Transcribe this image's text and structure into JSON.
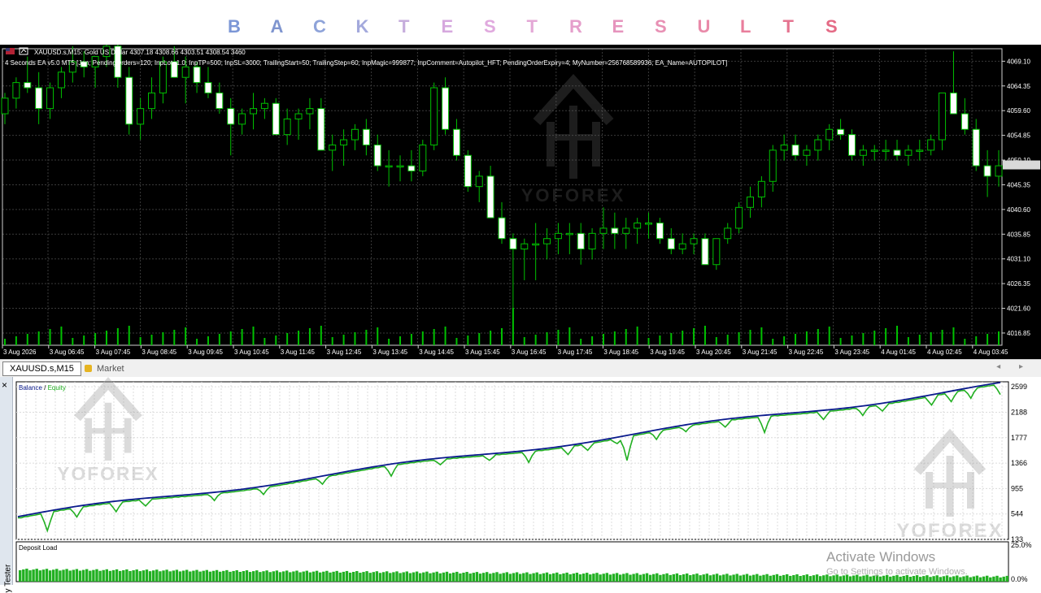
{
  "banner": {
    "letters": [
      "B",
      "A",
      "C",
      "K",
      "T",
      "E",
      "S",
      "T",
      "R",
      "E",
      "S",
      "U",
      "L",
      "T",
      "S"
    ],
    "colors": [
      "#7b96d6",
      "#7f95cf",
      "#8ea3d9",
      "#a3a9dc",
      "#c6addc",
      "#d6a8de",
      "#e0a9de",
      "#e4a8d6",
      "#e59fcb",
      "#e694bd",
      "#e890b4",
      "#e98aa9",
      "#e97e9c",
      "#e57490",
      "#e46a85"
    ]
  },
  "symbol_line": "XAUUSD.s,M15:  Gold US Dollar  4307.18 4308.66 4303.51 4308.54  3460",
  "ea_line": "4 Seconds EA v5.0 MT5 [Jan; PendingOrders=120; InpLot=1.0; InpTP=500; InpSL=3000; TrailingStart=50; TrailingStep=60; InpMagic=999877; InpComment=Autopilot_HFT; PendingOrderExpiry=4; MyNumber=256768589936; EA_Name=AUTOPILOT]",
  "watermark_text": "YOFOREX",
  "price_axis": [
    "4069.10",
    "4064.35",
    "4059.60",
    "4054.85",
    "4050.10",
    "4045.35",
    "4040.60",
    "4035.85",
    "4031.10",
    "4026.35",
    "4021.60",
    "4016.85"
  ],
  "time_axis": [
    "3 Aug 2026",
    "3 Aug 06:45",
    "3 Aug 07:45",
    "3 Aug 08:45",
    "3 Aug 09:45",
    "3 Aug 10:45",
    "3 Aug 11:45",
    "3 Aug 12:45",
    "3 Aug 13:45",
    "3 Aug 14:45",
    "3 Aug 15:45",
    "3 Aug 16:45",
    "3 Aug 17:45",
    "3 Aug 18:45",
    "3 Aug 19:45",
    "3 Aug 20:45",
    "3 Aug 21:45",
    "3 Aug 22:45",
    "3 Aug 23:45",
    "4 Aug 01:45",
    "4 Aug 02:45",
    "4 Aug 03:45"
  ],
  "candles": [
    [
      4059,
      4063,
      4057,
      4062
    ],
    [
      4062,
      4066,
      4060,
      4065
    ],
    [
      4065,
      4070,
      4063,
      4064
    ],
    [
      4064,
      4067,
      4057,
      4060
    ],
    [
      4060,
      4065,
      4058,
      4064
    ],
    [
      4064,
      4068,
      4062,
      4067
    ],
    [
      4067,
      4072,
      4065,
      4069
    ],
    [
      4069,
      4071,
      4066,
      4068
    ],
    [
      4068,
      4070,
      4064,
      4070
    ],
    [
      4070,
      4075,
      4068,
      4072
    ],
    [
      4072,
      4073,
      4064,
      4066
    ],
    [
      4066,
      4068,
      4055,
      4057
    ],
    [
      4057,
      4062,
      4054,
      4060
    ],
    [
      4060,
      4066,
      4058,
      4063
    ],
    [
      4063,
      4070,
      4061,
      4069
    ],
    [
      4069,
      4072,
      4066,
      4066
    ],
    [
      4066,
      4070,
      4061,
      4068
    ],
    [
      4068,
      4069,
      4063,
      4065
    ],
    [
      4065,
      4068,
      4062,
      4063
    ],
    [
      4063,
      4065,
      4059,
      4060
    ],
    [
      4060,
      4062,
      4051,
      4057
    ],
    [
      4057,
      4060,
      4055,
      4059
    ],
    [
      4059,
      4063,
      4056,
      4060
    ],
    [
      4060,
      4062,
      4058,
      4061
    ],
    [
      4061,
      4062,
      4056,
      4055
    ],
    [
      4055,
      4060,
      4053,
      4058
    ],
    [
      4058,
      4060,
      4054,
      4059
    ],
    [
      4059,
      4062,
      4056,
      4060
    ],
    [
      4060,
      4062,
      4052,
      4052
    ],
    [
      4052,
      4055,
      4048,
      4053
    ],
    [
      4053,
      4056,
      4049,
      4054
    ],
    [
      4054,
      4057,
      4052,
      4056
    ],
    [
      4056,
      4058,
      4051,
      4053
    ],
    [
      4053,
      4055,
      4048,
      4049
    ],
    [
      4049,
      4052,
      4045,
      4049
    ],
    [
      4049,
      4051,
      4046,
      4049
    ],
    [
      4049,
      4052,
      4046,
      4048
    ],
    [
      4048,
      4054,
      4047,
      4053
    ],
    [
      4053,
      4065,
      4052,
      4064
    ],
    [
      4064,
      4066,
      4055,
      4056
    ],
    [
      4056,
      4058,
      4050,
      4051
    ],
    [
      4051,
      4052,
      4044,
      4045
    ],
    [
      4045,
      4048,
      4042,
      4047
    ],
    [
      4047,
      4049,
      4039,
      4039
    ],
    [
      4039,
      4042,
      4034,
      4035
    ],
    [
      4035,
      4036,
      4017,
      4033
    ],
    [
      4033,
      4035,
      4027,
      4034
    ],
    [
      4034,
      4038,
      4027,
      4034
    ],
    [
      4034,
      4037,
      4031,
      4035
    ],
    [
      4035,
      4038,
      4032,
      4036
    ],
    [
      4036,
      4038,
      4032,
      4036
    ],
    [
      4036,
      4038,
      4030,
      4033
    ],
    [
      4033,
      4037,
      4031,
      4036
    ],
    [
      4036,
      4041,
      4033,
      4037
    ],
    [
      4037,
      4040,
      4033,
      4036
    ],
    [
      4036,
      4039,
      4033,
      4037
    ],
    [
      4037,
      4039,
      4034,
      4038
    ],
    [
      4038,
      4040,
      4035,
      4038
    ],
    [
      4038,
      4039,
      4034,
      4035
    ],
    [
      4035,
      4037,
      4032,
      4033
    ],
    [
      4033,
      4036,
      4032,
      4034
    ],
    [
      4034,
      4036,
      4032,
      4035
    ],
    [
      4035,
      4036,
      4030,
      4030
    ],
    [
      4030,
      4035,
      4029,
      4035
    ],
    [
      4035,
      4038,
      4034,
      4037
    ],
    [
      4037,
      4042,
      4036,
      4041
    ],
    [
      4041,
      4045,
      4039,
      4043
    ],
    [
      4043,
      4047,
      4041,
      4046
    ],
    [
      4046,
      4053,
      4044,
      4052
    ],
    [
      4052,
      4055,
      4050,
      4053
    ],
    [
      4053,
      4055,
      4050,
      4051
    ],
    [
      4051,
      4053,
      4049,
      4052
    ],
    [
      4052,
      4055,
      4050,
      4054
    ],
    [
      4054,
      4057,
      4052,
      4056
    ],
    [
      4056,
      4058,
      4054,
      4055
    ],
    [
      4055,
      4056,
      4050,
      4051
    ],
    [
      4051,
      4053,
      4049,
      4052
    ],
    [
      4052,
      4053,
      4050,
      4052
    ],
    [
      4052,
      4054,
      4050,
      4052
    ],
    [
      4052,
      4054,
      4050,
      4051
    ],
    [
      4051,
      4053,
      4049,
      4052
    ],
    [
      4052,
      4054,
      4050,
      4052
    ],
    [
      4052,
      4055,
      4051,
      4054
    ],
    [
      4054,
      4057,
      4052,
      4063
    ],
    [
      4063,
      4071,
      4061,
      4059
    ],
    [
      4059,
      4062,
      4055,
      4056
    ],
    [
      4056,
      4058,
      4048,
      4049
    ],
    [
      4049,
      4052,
      4043,
      4047
    ],
    [
      4047,
      4052,
      4045,
      4049
    ]
  ],
  "tabs": {
    "active": "XAUUSD.s,M15",
    "market": "Market",
    "arrows": "◂ ▸"
  },
  "tester": {
    "legend_balance": "Balance",
    "legend_sep": " / ",
    "legend_equity": "Equity",
    "side_label": "y Tester",
    "close": "×",
    "y_axis": [
      "2599",
      "2188",
      "1777",
      "1366",
      "955",
      "544",
      "133"
    ],
    "balance_start": 500,
    "balance_end": 2630,
    "dips": [
      [
        0.03,
        0.7
      ],
      [
        0.06,
        0.35
      ],
      [
        0.1,
        0.35
      ],
      [
        0.13,
        0.25
      ],
      [
        0.2,
        0.25
      ],
      [
        0.25,
        0.25
      ],
      [
        0.31,
        0.25
      ],
      [
        0.38,
        0.4
      ],
      [
        0.43,
        0.2
      ],
      [
        0.48,
        0.2
      ],
      [
        0.52,
        0.4
      ],
      [
        0.56,
        0.3
      ],
      [
        0.58,
        0.25
      ],
      [
        0.61,
        0.2
      ],
      [
        0.62,
        0.9
      ],
      [
        0.65,
        0.3
      ],
      [
        0.68,
        0.2
      ],
      [
        0.72,
        0.25
      ],
      [
        0.76,
        0.6
      ],
      [
        0.82,
        0.3
      ],
      [
        0.86,
        0.3
      ],
      [
        0.88,
        0.25
      ],
      [
        0.93,
        0.35
      ],
      [
        0.95,
        0.35
      ],
      [
        0.97,
        0.35
      ],
      [
        1.0,
        0.4
      ]
    ],
    "deposit_label": "Deposit Load",
    "deposit_axis": [
      "25.0%",
      "0.0%"
    ]
  },
  "overlay": {
    "activate": "Activate Windows",
    "activate_sub": "Go to Settings to activate Windows."
  },
  "colors": {
    "bull": "#ffffff",
    "bear": "#ffffff",
    "wick": "#00c000",
    "volume": "#00c000",
    "balance": "#0a1a8c",
    "equity": "#22b022",
    "deposit": "#22b022"
  }
}
